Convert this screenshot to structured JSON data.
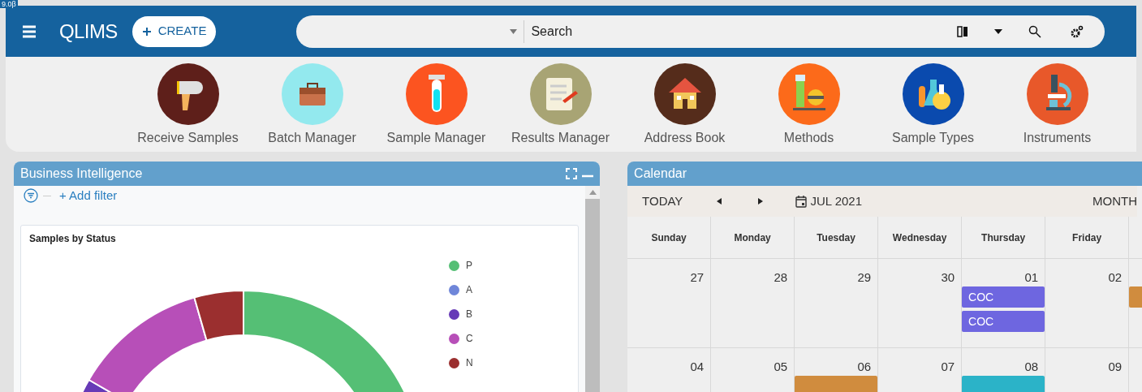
{
  "version": "9.0β",
  "header": {
    "brand": "QLIMS",
    "create_button": "CREATE",
    "search": {
      "placeholder": "Search"
    }
  },
  "launcher": [
    {
      "label": "Receive Samples"
    },
    {
      "label": "Batch Manager"
    },
    {
      "label": "Sample Manager"
    },
    {
      "label": "Results Manager"
    },
    {
      "label": "Address Book"
    },
    {
      "label": "Methods"
    },
    {
      "label": "Sample Types"
    },
    {
      "label": "Instruments"
    }
  ],
  "business_intelligence": {
    "title": "Business Intelligence",
    "add_filter": "+ Add filter",
    "chart": {
      "title": "Samples by Status",
      "legend": [
        {
          "label": "P",
          "color": "#55bf75"
        },
        {
          "label": "A",
          "color": "#6f86d9"
        },
        {
          "label": "B",
          "color": "#673ab7"
        },
        {
          "label": "C",
          "color": "#b74fb8"
        },
        {
          "label": "N",
          "color": "#9b2f2f"
        }
      ]
    }
  },
  "calendar": {
    "title": "Calendar",
    "today": "TODAY",
    "month_label": "JUL 2021",
    "view": "MONTH",
    "weekdays": [
      "Sunday",
      "Monday",
      "Tuesday",
      "Wednesday",
      "Thursday",
      "Friday"
    ],
    "weeks": [
      {
        "days": [
          {
            "date": "27"
          },
          {
            "date": "28"
          },
          {
            "date": "29"
          },
          {
            "date": "30"
          },
          {
            "date": "01",
            "events": [
              {
                "label": "COC",
                "color": "#6e66e0"
              },
              {
                "label": "COC",
                "color": "#6e66e0"
              }
            ]
          },
          {
            "date": "02"
          },
          {
            "events": [
              {
                "color": "#d08c3e"
              }
            ]
          }
        ]
      },
      {
        "days": [
          {
            "date": "04"
          },
          {
            "date": "05"
          },
          {
            "date": "06",
            "events": [
              {
                "color": "#d08c3e"
              }
            ]
          },
          {
            "date": "07"
          },
          {
            "date": "08",
            "events": [
              {
                "color": "#2bb3c8"
              }
            ]
          },
          {
            "date": "09"
          }
        ]
      }
    ]
  }
}
